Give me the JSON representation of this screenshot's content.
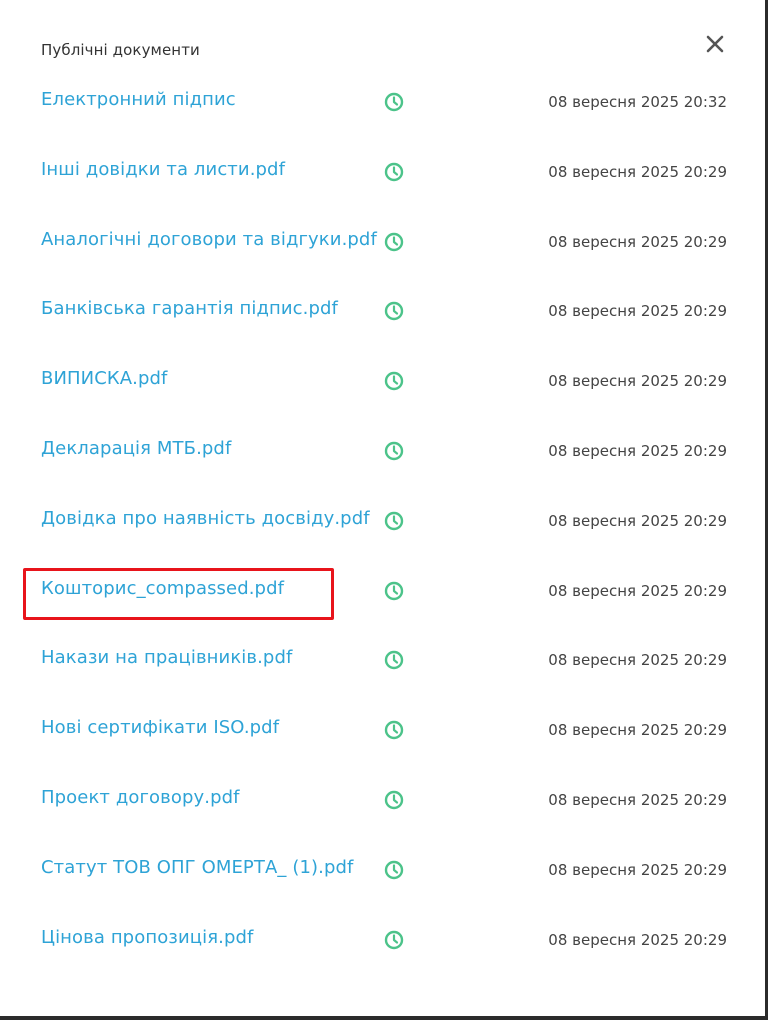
{
  "modal": {
    "title": "Публічні документи",
    "close_icon": "close-icon",
    "status_icon": "clock-icon",
    "status_color": "#4cc38a",
    "link_color": "#2ea3d6",
    "highlight_color": "#e8141b"
  },
  "documents": [
    {
      "name": "Електронний підпис",
      "date": "08 вересня 2025 20:32"
    },
    {
      "name": "Інші довідки та листи.pdf",
      "date": "08 вересня 2025 20:29"
    },
    {
      "name": "Аналогічні договори та відгуки.pdf",
      "date": "08 вересня 2025 20:29"
    },
    {
      "name": "Банківська гарантія підпис.pdf",
      "date": "08 вересня 2025 20:29"
    },
    {
      "name": "ВИПИСКА.pdf",
      "date": "08 вересня 2025 20:29"
    },
    {
      "name": "Декларація МТБ.pdf",
      "date": "08 вересня 2025 20:29"
    },
    {
      "name": "Довідка про наявність досвіду.pdf",
      "date": "08 вересня 2025 20:29"
    },
    {
      "name": "Кошторис_compassed.pdf",
      "date": "08 вересня 2025 20:29",
      "highlighted": true
    },
    {
      "name": "Накази на працівників.pdf",
      "date": "08 вересня 2025 20:29"
    },
    {
      "name": "Нові сертифікати ISO.pdf",
      "date": "08 вересня 2025 20:29"
    },
    {
      "name": "Проект договору.pdf",
      "date": "08 вересня 2025 20:29"
    },
    {
      "name": "Статут ТОВ ОПГ ОМЕРТА_ (1).pdf",
      "date": "08 вересня 2025 20:29"
    },
    {
      "name": "Цінова пропозиція.pdf",
      "date": "08 вересня 2025 20:29"
    }
  ]
}
